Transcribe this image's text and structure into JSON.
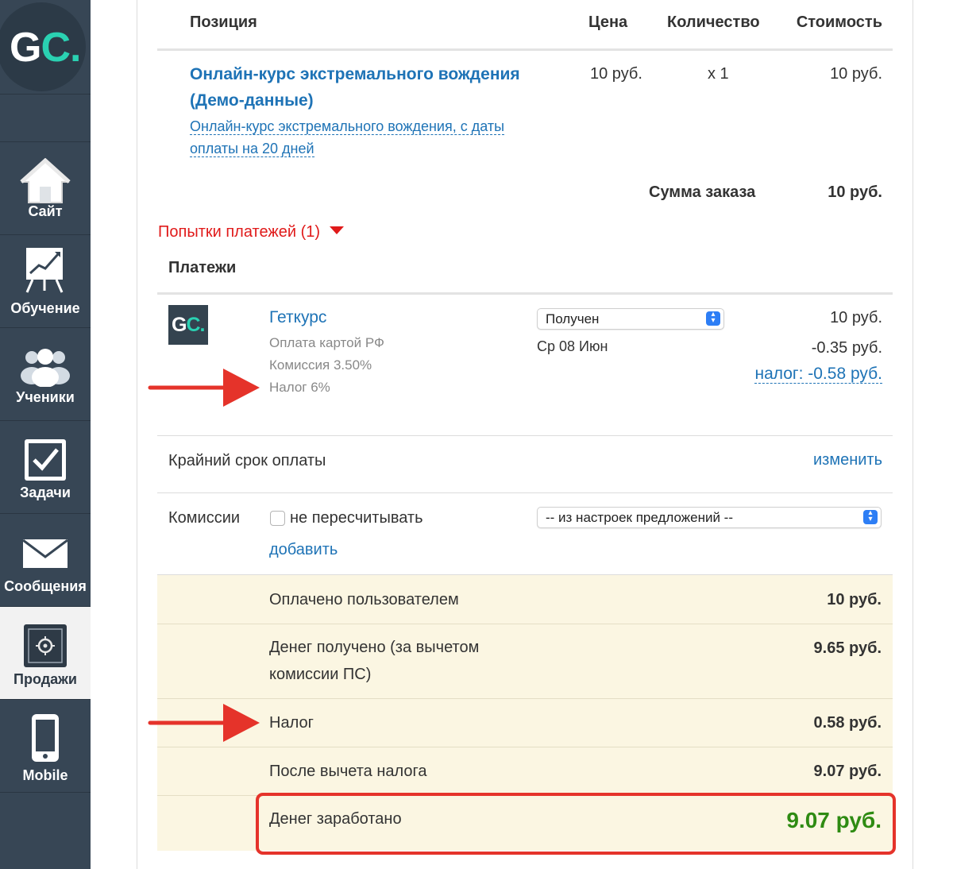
{
  "sidebar": {
    "logo": {
      "g": "G",
      "c": "C",
      "dot": "."
    },
    "items": [
      {
        "label": "Сайт",
        "icon": "home-icon"
      },
      {
        "label": "Обучение",
        "icon": "chart-board-icon"
      },
      {
        "label": "Ученики",
        "icon": "users-icon"
      },
      {
        "label": "Задачи",
        "icon": "checkbox-icon"
      },
      {
        "label": "Сообщения",
        "icon": "envelope-icon"
      },
      {
        "label": "Продажи",
        "icon": "safe-icon",
        "active": true
      },
      {
        "label": "Mobile",
        "icon": "phone-icon"
      }
    ]
  },
  "order": {
    "headers": {
      "position": "Позиция",
      "price": "Цена",
      "quantity": "Количество",
      "cost": "Стоимость"
    },
    "item": {
      "title_line1": "Онлайн-курс экстремального вождения",
      "title_line2": "(Демо-данные)",
      "offer_line1": "Онлайн-курс экстремального вождения, с даты",
      "offer_line2": "оплаты на 20 дней",
      "price": "10 руб.",
      "quantity": "x 1",
      "cost": "10 руб."
    },
    "total_label": "Сумма заказа",
    "total_value": "10 руб."
  },
  "payment_attempts": {
    "label": "Попытки платежей (1)"
  },
  "payments": {
    "heading": "Платежи",
    "provider": {
      "name": "Геткурс",
      "logo_g": "G",
      "logo_c": "C",
      "logo_dot": "."
    },
    "method": "Оплата картой РФ",
    "commission": "Комиссия 3.50%",
    "tax": "Налог 6%",
    "status_selected": "Получен",
    "date": "Ср 08 Июн",
    "amount": "10 руб.",
    "fee": "-0.35 руб.",
    "tax_link": "налог: -0.58 руб."
  },
  "deadline": {
    "label": "Крайний срок оплаты",
    "action": "изменить"
  },
  "commissions": {
    "label": "Комиссии",
    "checkbox_label": "не пересчитывать",
    "checked": false,
    "select_value": "-- из настроек предложений --",
    "add_link": "добавить"
  },
  "summary": [
    {
      "label": "Оплачено пользователем",
      "value": "10 руб."
    },
    {
      "label_line1": "Денег получено (за вычетом",
      "label_line2": "комиссии ПС)",
      "value": "9.65 руб."
    },
    {
      "label": "Налог",
      "value": "0.58 руб."
    },
    {
      "label": "После вычета налога",
      "value": "9.07 руб."
    },
    {
      "label": "Денег заработано",
      "value": "9.07 руб."
    }
  ],
  "colors": {
    "sidebar_bg": "#374655",
    "accent_teal": "#2ad1b2",
    "link_blue": "#1e73b6",
    "attempts_red": "#e01a1a",
    "annotation_red": "#e5332a",
    "earned_green": "#2e8b12",
    "summary_bg": "#fbf6e2"
  }
}
